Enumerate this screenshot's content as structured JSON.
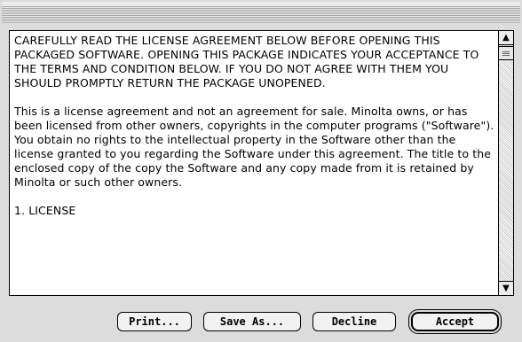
{
  "dialog": {
    "paragraphs": [
      "CAREFULLY READ THE LICENSE AGREEMENT BELOW BEFORE OPENING THIS PACKAGED SOFTWARE. OPENING THIS PACKAGE INDICATES YOUR ACCEPTANCE TO THE TERMS AND CONDITION BELOW. IF YOU DO NOT AGREE WITH THEM YOU SHOULD PROMPTLY RETURN THE PACKAGE UNOPENED.",
      "This is a license agreement and not an agreement for sale. Minolta owns, or has been licensed from other owners, copyrights in the computer programs (\"Software\"). You obtain no rights to the intellectual property in the Software other than the license granted to you regarding the Software under this agreement. The title to the enclosed copy of the copy the Software and any copy made from it is retained by Minolta or such other owners.",
      "1. LICENSE"
    ],
    "buttons": {
      "print": "Print...",
      "save_as": "Save As...",
      "decline": "Decline",
      "accept": "Accept"
    }
  },
  "icons": {
    "scroll_up": "up-arrow-icon",
    "scroll_down": "down-arrow-icon"
  }
}
